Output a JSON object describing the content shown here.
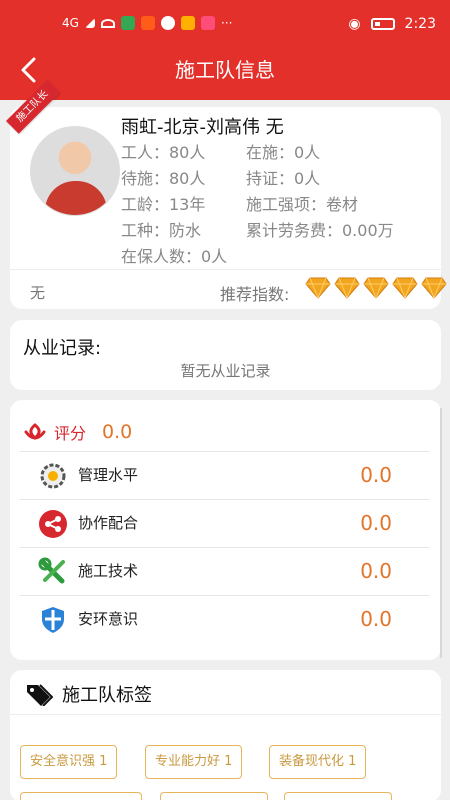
{
  "status_bar": {
    "signal": "4G",
    "time": "2:23",
    "more": "···"
  },
  "header": {
    "title": "施工队信息"
  },
  "team": {
    "badge": "施工队长",
    "name": "雨虹-北京-刘高伟 无",
    "workers": "工人：80人",
    "in_construction": "在施：0人",
    "waiting": "待施：80人",
    "certified": "持证：0人",
    "seniority": "工龄：13年",
    "specialty": "施工强项：卷材",
    "trade": "工种：防水",
    "total_fee": "累计劳务费：0.00万",
    "insured": "在保人数：0人",
    "remark": "无",
    "recommend_label": "推荐指数:",
    "recommend_stars": 5
  },
  "record": {
    "title": "从业记录:",
    "empty": "暂无从业记录"
  },
  "scores": {
    "label": "评分",
    "value": "0.0",
    "items": [
      {
        "label": "管理水平",
        "value": "0.0",
        "icon": "gear-icon"
      },
      {
        "label": "协作配合",
        "value": "0.0",
        "icon": "share-icon"
      },
      {
        "label": "施工技术",
        "value": "0.0",
        "icon": "tools-icon"
      },
      {
        "label": "安环意识",
        "value": "0.0",
        "icon": "shield-icon"
      }
    ]
  },
  "tags": {
    "title": "施工队标签",
    "items": [
      "安全意识强 1",
      "专业能力好 1",
      "装备现代化 1"
    ]
  },
  "colors": {
    "primary": "#e3302b",
    "score": "#e1762a",
    "tag": "#e8b45c"
  }
}
